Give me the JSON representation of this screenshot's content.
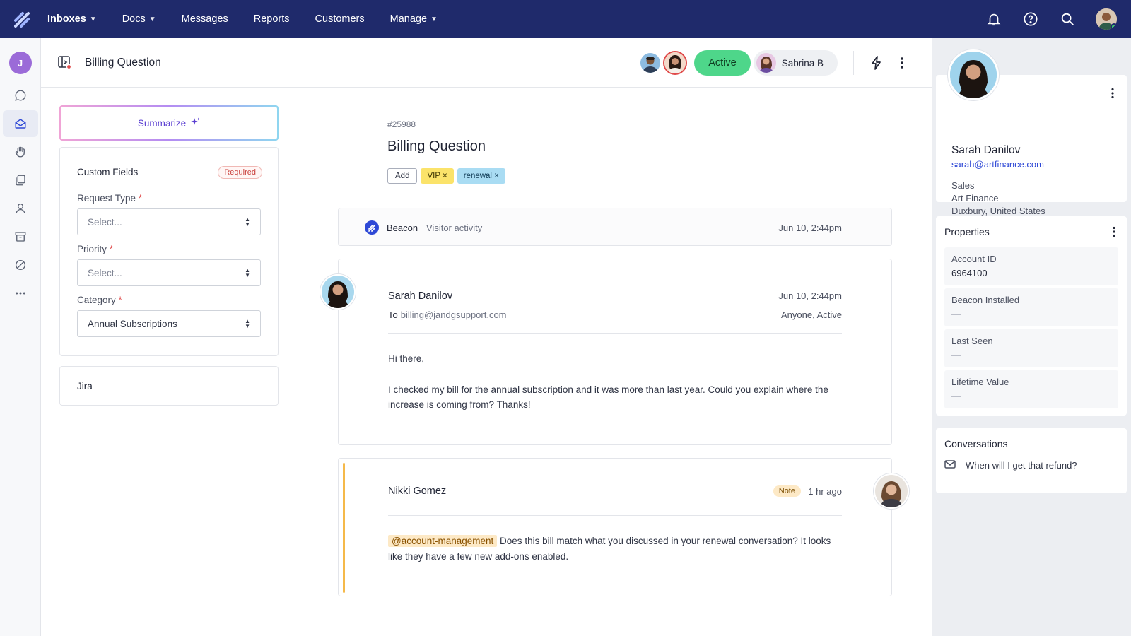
{
  "nav": {
    "items": [
      {
        "label": "Inboxes",
        "dropdown": true
      },
      {
        "label": "Docs",
        "dropdown": true
      },
      {
        "label": "Messages",
        "dropdown": false
      },
      {
        "label": "Reports",
        "dropdown": false
      },
      {
        "label": "Customers",
        "dropdown": false
      },
      {
        "label": "Manage",
        "dropdown": true
      }
    ],
    "icons": [
      "bell-icon",
      "help-icon",
      "search-icon",
      "user-avatar"
    ]
  },
  "rail": {
    "avatar_initial": "J",
    "icons": [
      "chat-icon",
      "inbox-icon",
      "hand-icon",
      "docs-icon",
      "person-icon",
      "archive-icon",
      "blocked-icon",
      "more-icon"
    ]
  },
  "header": {
    "title": "Billing Question",
    "status": "Active",
    "assignee": "Sabrina B"
  },
  "left": {
    "summarize_label": "Summarize",
    "custom_fields_title": "Custom Fields",
    "required_badge": "Required",
    "fields": [
      {
        "label": "Request Type",
        "value": "Select...",
        "required": "*"
      },
      {
        "label": "Priority",
        "value": "Select...",
        "required": "*"
      },
      {
        "label": "Category",
        "value": "Annual Subscriptions",
        "required": "*"
      }
    ],
    "jira_label": "Jira"
  },
  "ticket": {
    "number": "#25988",
    "title": "Billing Question",
    "tags": {
      "add": "Add",
      "vip": "VIP",
      "renewal": "renewal"
    }
  },
  "beacon": {
    "name": "Beacon",
    "activity": "Visitor activity",
    "time": "Jun 10, 2:44pm"
  },
  "message": {
    "sender": "Sarah Danilov",
    "time": "Jun 10, 2:44pm",
    "to_label": "To",
    "to": "billing@jandgsupport.com",
    "status": "Anyone, Active",
    "greeting": "Hi there,",
    "body": "I checked my bill for the annual subscription and it was more than last year. Could you explain where the increase is coming from? Thanks!"
  },
  "note": {
    "author": "Nikki Gomez",
    "badge": "Note",
    "time": "1 hr ago",
    "mention": "@account-management",
    "body": "Does this bill match what you discussed in your renewal conversation? It looks like they have a few new add-ons enabled."
  },
  "profile": {
    "name": "Sarah Danilov",
    "email": "sarah@artfinance.com",
    "department": "Sales",
    "company": "Art Finance",
    "location": "Duxbury, United States"
  },
  "properties": {
    "title": "Properties",
    "items": [
      {
        "label": "Account ID",
        "value": "6964100"
      },
      {
        "label": "Beacon Installed",
        "value": "—"
      },
      {
        "label": "Last Seen",
        "value": "—"
      },
      {
        "label": "Lifetime Value",
        "value": "—"
      }
    ]
  },
  "conversations": {
    "title": "Conversations",
    "items": [
      {
        "subject": "When will I get that refund?"
      }
    ]
  },
  "colors": {
    "nav_bg": "#1f2a6b",
    "active_green": "#4ed68a",
    "link_blue": "#2f49d6",
    "note_orange": "#f5b94a",
    "vip_yellow": "#fbe36a",
    "renewal_blue": "#a9dcf3"
  }
}
